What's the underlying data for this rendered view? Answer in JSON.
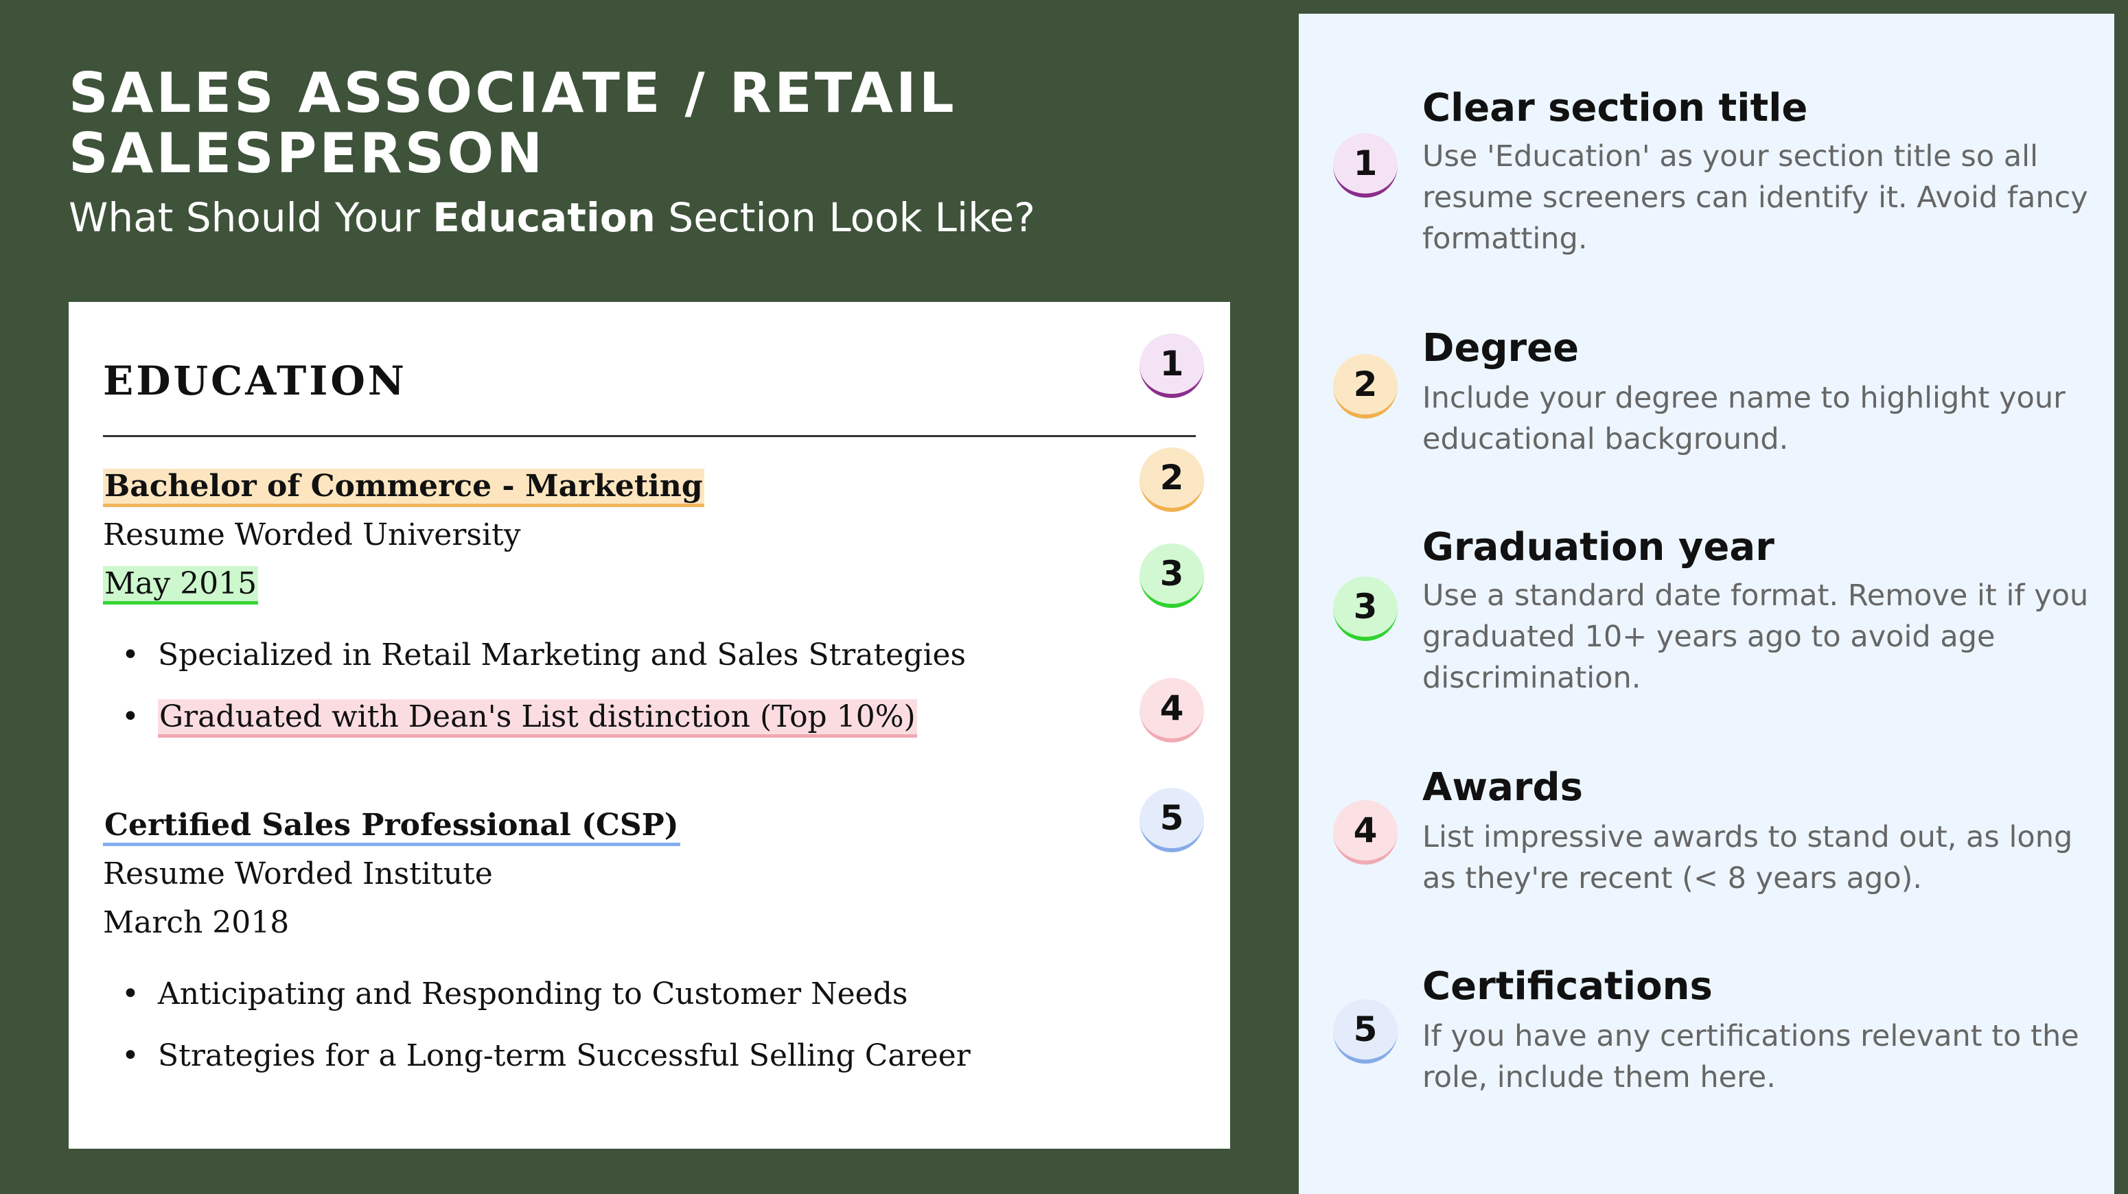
{
  "header": {
    "title": "SALES ASSOCIATE / RETAIL SALESPERSON",
    "subtitle_before": "What Should Your ",
    "subtitle_bold": "Education",
    "subtitle_after": " Section Look Like?"
  },
  "resume": {
    "section_title": "EDUCATION",
    "entries": [
      {
        "degree": "Bachelor of Commerce - Marketing",
        "school": "Resume Worded University",
        "date": "May 2015",
        "bullets": [
          "Specialized in Retail Marketing and Sales Strategies",
          "Graduated with Dean's List distinction (Top 10%)"
        ]
      },
      {
        "degree": "Certified Sales Professional (CSP)",
        "school": "Resume Worded Institute",
        "date": "March 2018",
        "bullets": [
          "Anticipating and Responding to Customer Needs",
          "Strategies for a Long-term Successful Selling Career"
        ]
      }
    ],
    "bullet_char": "•"
  },
  "badges": [
    "1",
    "2",
    "3",
    "4",
    "5"
  ],
  "tips": [
    {
      "number": "1",
      "title": "Clear section title",
      "description": "Use 'Education' as your section title so all resume screeners can identify it. Avoid fancy formatting."
    },
    {
      "number": "2",
      "title": "Degree",
      "description": "Include your degree name to highlight your educational background."
    },
    {
      "number": "3",
      "title": "Graduation year",
      "description": "Use a standard date format. Remove it if you graduated 10+ years ago to avoid age discrimination."
    },
    {
      "number": "4",
      "title": "Awards",
      "description": "List impressive awards to stand out, as long as they're recent (< 8 years ago)."
    },
    {
      "number": "5",
      "title": "Certifications",
      "description": "If you have any certifications relevant to the role, include them here."
    }
  ],
  "colors": {
    "background": "#3e533a",
    "panel": "#edf6fe",
    "badge_1": "#8b2e8c",
    "badge_2": "#f1b04d",
    "badge_3": "#2fd22f",
    "badge_4": "#f0aab3",
    "badge_5": "#86aae8"
  }
}
